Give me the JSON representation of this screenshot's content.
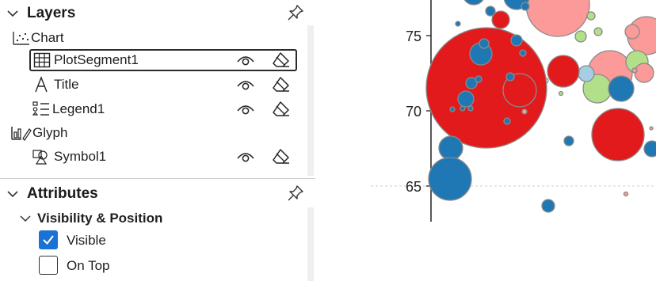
{
  "layers_panel": {
    "title": "Layers",
    "chart_group": {
      "label": "Chart"
    },
    "items": [
      {
        "label": "PlotSegment1",
        "selected": true
      },
      {
        "label": "Title",
        "selected": false
      },
      {
        "label": "Legend1",
        "selected": false
      }
    ],
    "glyph_group": {
      "label": "Glyph"
    },
    "glyph_items": [
      {
        "label": "Symbol1"
      }
    ]
  },
  "attributes_panel": {
    "title": "Attributes",
    "section": {
      "label": "Visibility & Position"
    },
    "visible": {
      "label": "Visible",
      "checked": true
    },
    "on_top": {
      "label": "On Top",
      "checked": false
    }
  },
  "colors": {
    "accent_blue": "#1a73d4",
    "bubble_red": "#e31a1c",
    "bubble_blue": "#1f78b4",
    "bubble_pink": "#fb9a99",
    "bubble_lightgreen": "#b2df8a",
    "bubble_lightblue": "#a6cee3"
  },
  "chart": {
    "y_ticks": [
      "75",
      "70",
      "65"
    ]
  }
}
